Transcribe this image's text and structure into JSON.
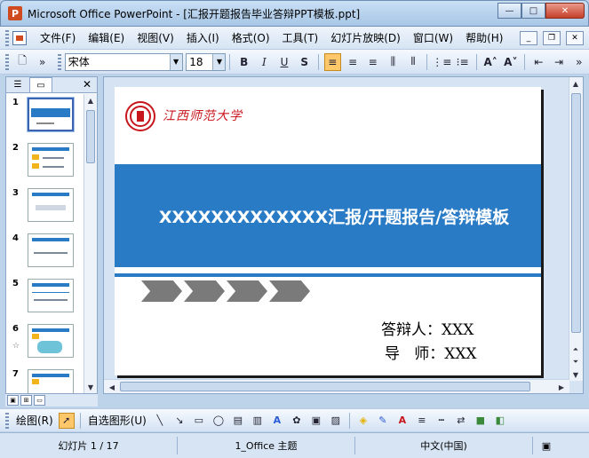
{
  "window": {
    "title": "Microsoft Office PowerPoint - [汇报开题报告毕业答辩PPT模板.ppt]",
    "app_icon": "P",
    "min_label": "—",
    "max_label": "□",
    "close_label": "✕"
  },
  "menu": {
    "items": [
      "文件(F)",
      "编辑(E)",
      "视图(V)",
      "插入(I)",
      "格式(O)",
      "工具(T)",
      "幻灯片放映(D)",
      "窗口(W)",
      "帮助(H)"
    ]
  },
  "toolbar": {
    "font_name": "宋体",
    "font_size": "18",
    "bold": "B",
    "italic": "I",
    "underline": "U",
    "shadow": "S"
  },
  "slides_pane": {
    "numbers": [
      "1",
      "2",
      "3",
      "4",
      "5",
      "6",
      "7"
    ],
    "selected": 1
  },
  "slide": {
    "logo_text": "江西师范大学",
    "title": "XXXXXXXXXXXXX汇报/开题报告/答辩模板",
    "presenter_label": "答辩人",
    "presenter_value": "XXX",
    "advisor_label": "导   师",
    "advisor_value": "XXX",
    "accent_color": "#2a7bc6"
  },
  "drawbar": {
    "draw_label": "绘图(R)",
    "autoshapes_label": "自选图形(U)"
  },
  "status": {
    "slide_info": "幻灯片 1 / 17",
    "theme": "1_Office 主题",
    "language": "中文(中国)"
  }
}
